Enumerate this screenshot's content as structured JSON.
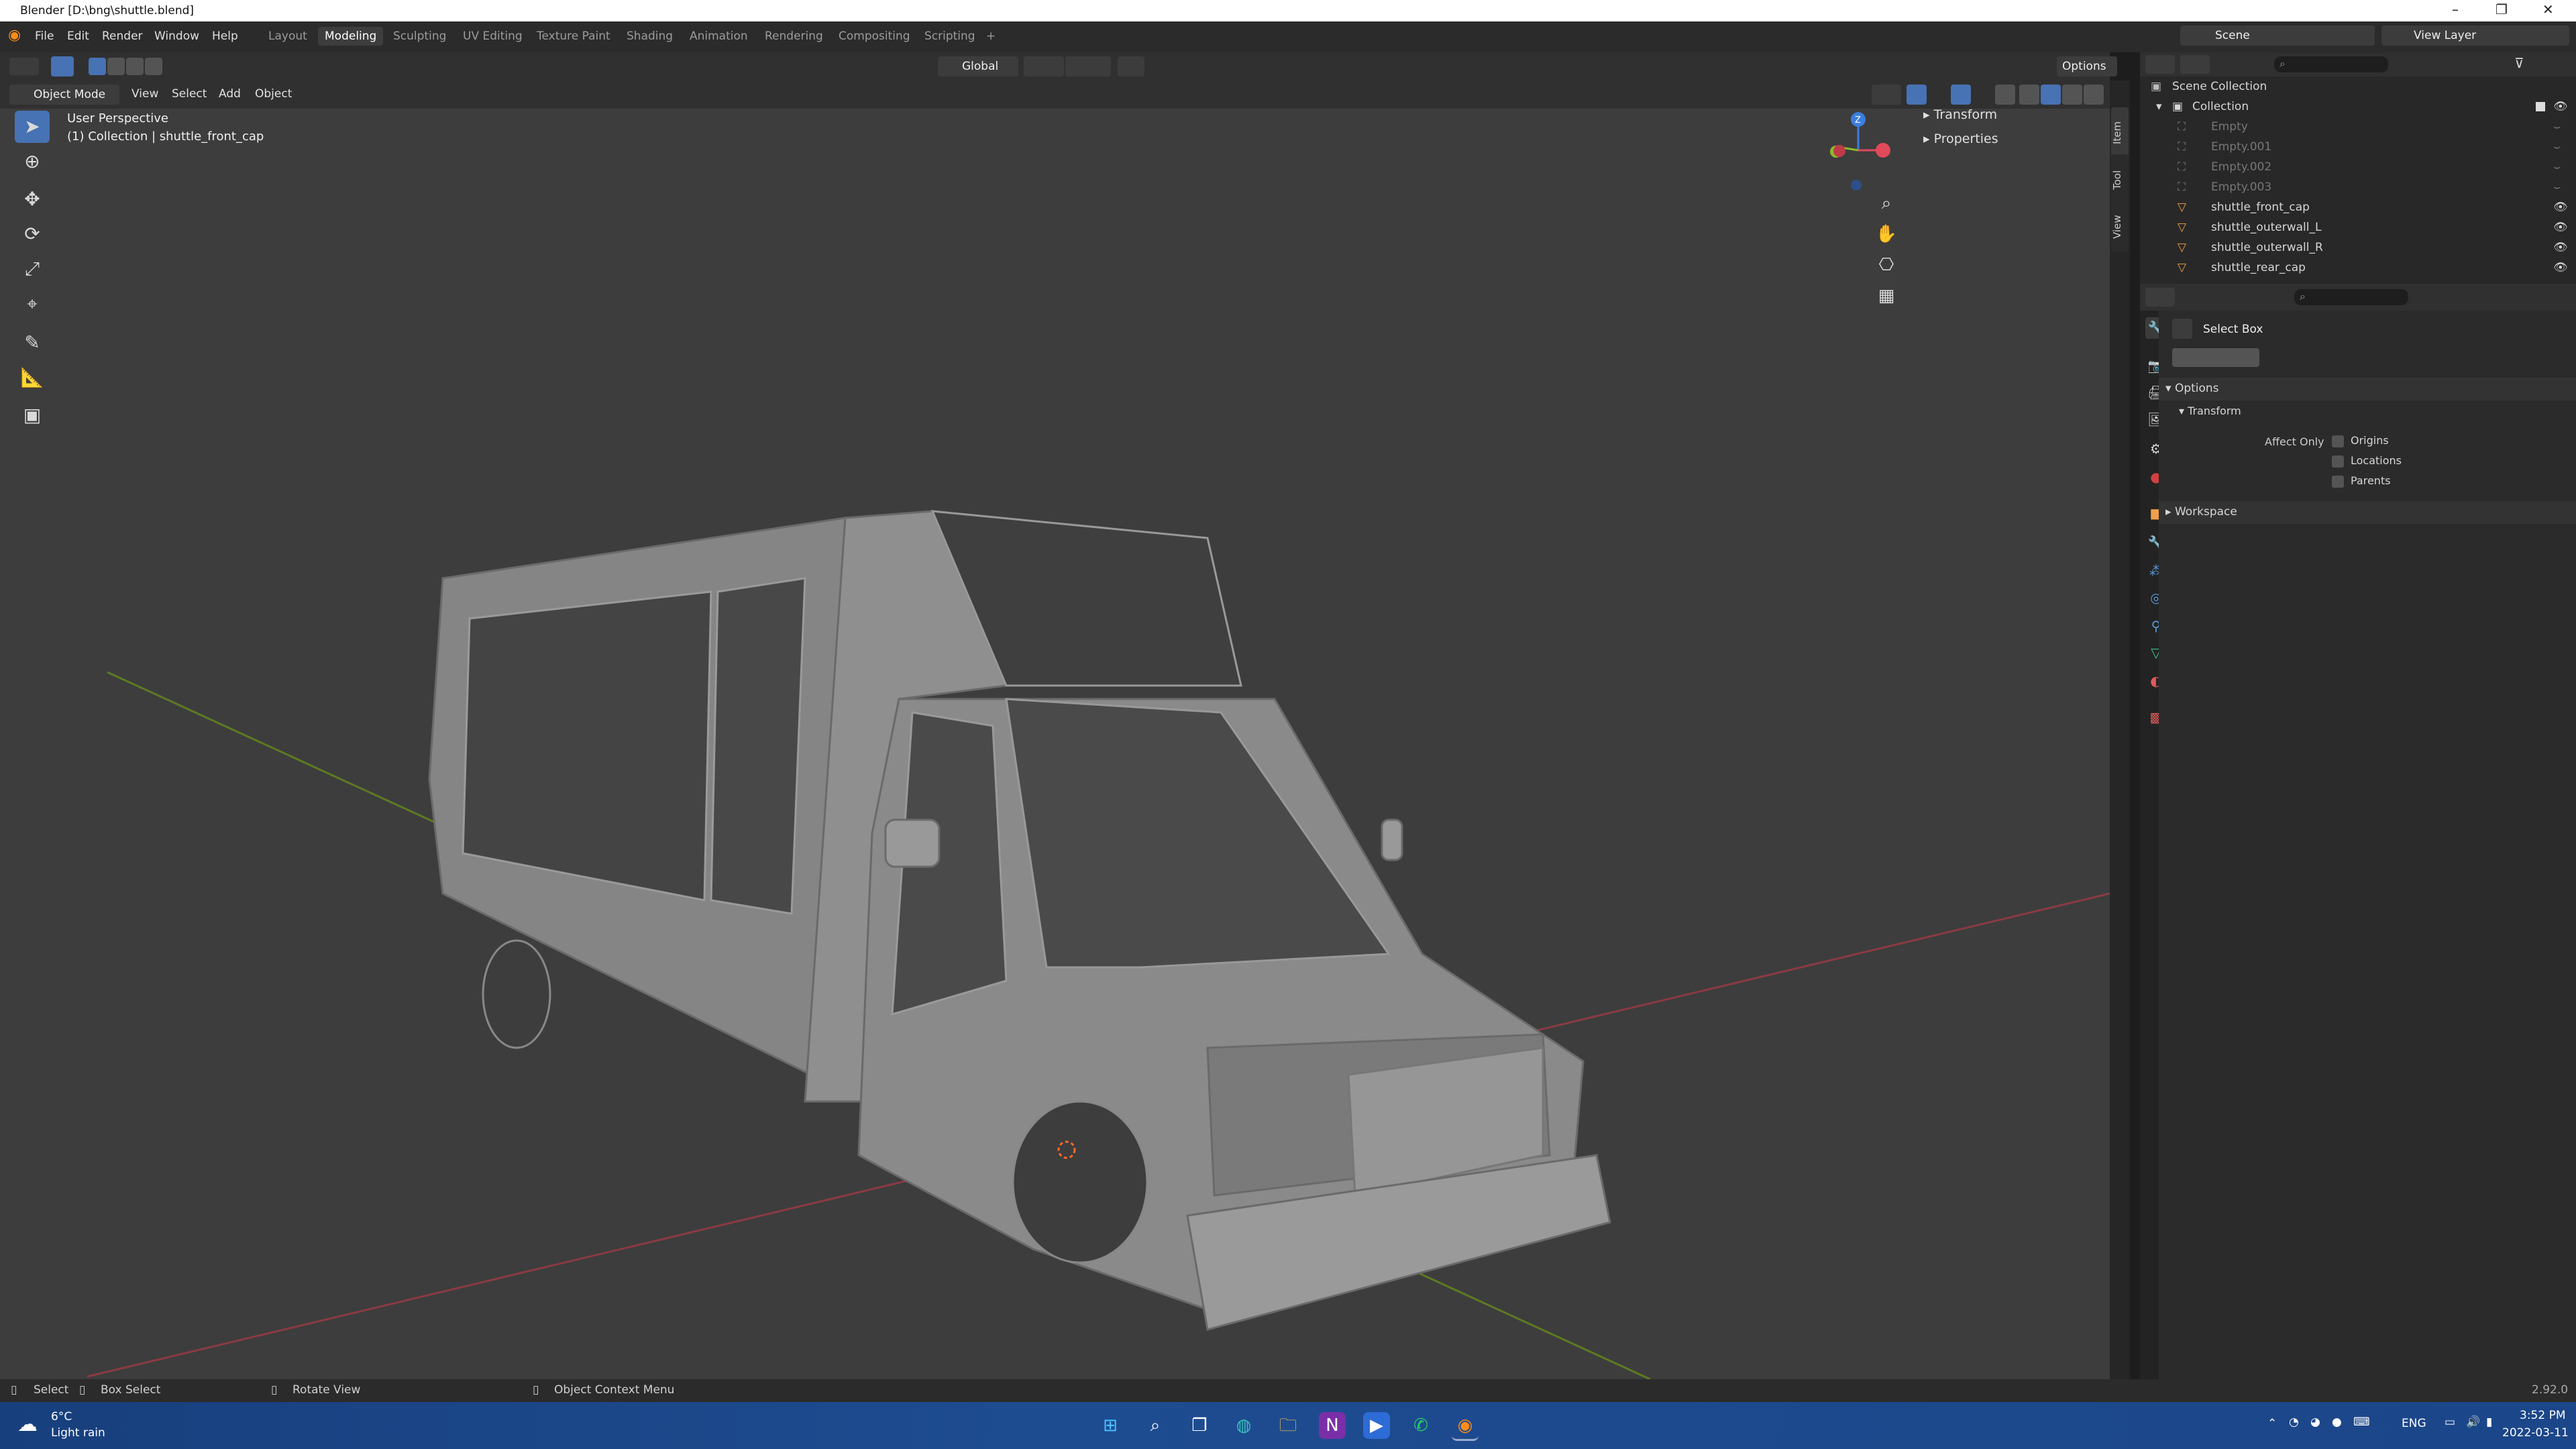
{
  "window": {
    "title": "Blender [D:\\bng\\shuttle.blend]",
    "minimize": "–",
    "maximize": "❐",
    "close": "✕"
  },
  "menu": [
    "File",
    "Edit",
    "Render",
    "Window",
    "Help"
  ],
  "workspaces": [
    "Layout",
    "Modeling",
    "Sculpting",
    "UV Editing",
    "Texture Paint",
    "Shading",
    "Animation",
    "Rendering",
    "Compositing",
    "Scripting",
    "+"
  ],
  "active_workspace": "Modeling",
  "scene": {
    "label": "Scene",
    "view_layer": "View Layer"
  },
  "tool_header": {
    "orientation": "Global",
    "options": "Options"
  },
  "view_header": {
    "mode": "Object Mode",
    "items": [
      "View",
      "Select",
      "Add",
      "Object"
    ]
  },
  "viewport": {
    "perspective": "User Perspective",
    "collection_line": "(1) Collection | shuttle_front_cap",
    "gizmo": {
      "x": "X",
      "y": "Y",
      "z": "Z"
    }
  },
  "npanel": {
    "transform": "Transform",
    "properties": "Properties",
    "tabs": [
      "Item",
      "Tool",
      "View"
    ]
  },
  "outliner": {
    "scene_collection": "Scene Collection",
    "collection": "Collection",
    "objects": [
      {
        "name": "Empty",
        "type": "empty",
        "visible": false
      },
      {
        "name": "Empty.001",
        "type": "empty",
        "visible": false
      },
      {
        "name": "Empty.002",
        "type": "empty",
        "visible": false
      },
      {
        "name": "Empty.003",
        "type": "empty",
        "visible": false
      },
      {
        "name": "shuttle_front_cap",
        "type": "mesh",
        "visible": true
      },
      {
        "name": "shuttle_outerwall_L",
        "type": "mesh",
        "visible": true
      },
      {
        "name": "shuttle_outerwall_R",
        "type": "mesh",
        "visible": true
      },
      {
        "name": "shuttle_rear_cap",
        "type": "mesh",
        "visible": true
      }
    ]
  },
  "properties": {
    "tool_name": "Select Box",
    "options": "Options",
    "transform": "Transform",
    "affect_only": "Affect Only",
    "checks": [
      "Origins",
      "Locations",
      "Parents"
    ],
    "workspace": "Workspace"
  },
  "statusbar": {
    "select": "Select",
    "box_select": "Box Select",
    "rotate": "Rotate View",
    "context": "Object Context Menu",
    "version": "2.92.0"
  },
  "taskbar": {
    "temp": "6°C",
    "weather": "Light rain",
    "lang": "ENG",
    "time": "3:52 PM",
    "date": "2022-03-11"
  },
  "colors": {
    "accent": "#4772b3",
    "viewport_bg": "#3d3d3d",
    "axis_x": "#e04a5a",
    "axis_y": "#8dbb2a",
    "axis_z": "#3b7ee0"
  }
}
